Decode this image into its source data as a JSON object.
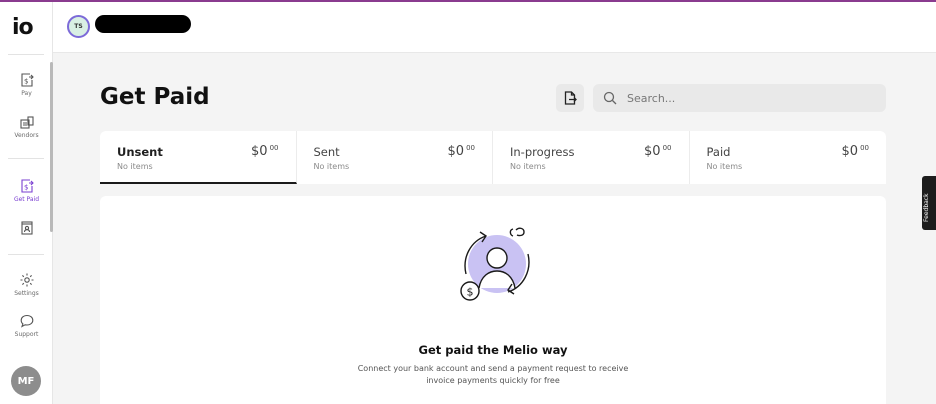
{
  "brand": {
    "logo_text": "io"
  },
  "sidebar": {
    "items": [
      {
        "label": "Pay",
        "icon": "dollar-arrow-icon"
      },
      {
        "label": "Vendors",
        "icon": "vendors-icon"
      },
      {
        "label": "Get Paid",
        "icon": "dollar-arrow-icon",
        "active": true
      },
      {
        "label": "",
        "icon": "contacts-icon"
      },
      {
        "label": "Settings",
        "icon": "gear-icon"
      },
      {
        "label": "Support",
        "icon": "chat-icon"
      }
    ],
    "user_initials": "MF"
  },
  "header": {
    "org_initials": "TS"
  },
  "page": {
    "title": "Get Paid",
    "search_placeholder": "Search..."
  },
  "tabs": [
    {
      "label": "Unsent",
      "count": "No items",
      "amount": "$0",
      "cents": "00",
      "active": true
    },
    {
      "label": "Sent",
      "count": "No items",
      "amount": "$0",
      "cents": "00"
    },
    {
      "label": "In-progress",
      "count": "No items",
      "amount": "$0",
      "cents": "00"
    },
    {
      "label": "Paid",
      "count": "No items",
      "amount": "$0",
      "cents": "00"
    }
  ],
  "empty_state": {
    "title": "Get paid the Melio way",
    "description": "Connect your bank account and send a payment request to receive invoice payments quickly for free"
  },
  "feedback_label": "Feedback",
  "colors": {
    "accent": "#7a3fd1",
    "illustration": "#c9c2f3",
    "topline": "#8a3b8f"
  }
}
